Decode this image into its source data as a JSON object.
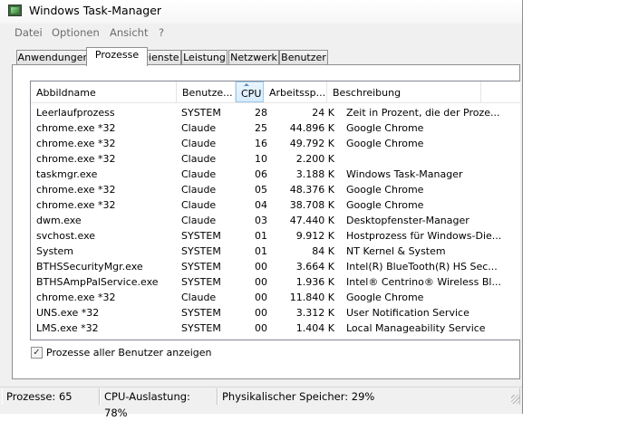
{
  "window": {
    "title": "Windows Task-Manager"
  },
  "menu": [
    "Datei",
    "Optionen",
    "Ansicht",
    "?"
  ],
  "tabs": [
    {
      "label": "Anwendungen",
      "active": false
    },
    {
      "label": "Prozesse",
      "active": true
    },
    {
      "label": "Dienste",
      "active": false
    },
    {
      "label": "Leistung",
      "active": false
    },
    {
      "label": "Netzwerk",
      "active": false
    },
    {
      "label": "Benutzer",
      "active": false
    }
  ],
  "table": {
    "columns": [
      "Abbildname",
      "Benutze...",
      "CPU",
      "Arbeitssp...",
      "Beschreibung"
    ],
    "sorted_column": "CPU",
    "rows": [
      [
        "Leerlaufprozess",
        "SYSTEM",
        "28",
        "24 K",
        "Zeit in Prozent, die der Proze..."
      ],
      [
        "chrome.exe *32",
        "Claude",
        "25",
        "44.896 K",
        "Google Chrome"
      ],
      [
        "chrome.exe *32",
        "Claude",
        "16",
        "49.792 K",
        "Google Chrome"
      ],
      [
        "chrome.exe *32",
        "Claude",
        "10",
        "2.200 K",
        ""
      ],
      [
        "taskmgr.exe",
        "Claude",
        "06",
        "3.188 K",
        "Windows Task-Manager"
      ],
      [
        "chrome.exe *32",
        "Claude",
        "05",
        "48.376 K",
        "Google Chrome"
      ],
      [
        "chrome.exe *32",
        "Claude",
        "04",
        "38.708 K",
        "Google Chrome"
      ],
      [
        "dwm.exe",
        "Claude",
        "03",
        "47.440 K",
        "Desktopfenster-Manager"
      ],
      [
        "svchost.exe",
        "SYSTEM",
        "01",
        "9.912 K",
        "Hostprozess für Windows-Die..."
      ],
      [
        "System",
        "SYSTEM",
        "01",
        "84 K",
        "NT Kernel & System"
      ],
      [
        "BTHSSecurityMgr.exe",
        "SYSTEM",
        "00",
        "3.664 K",
        "Intel(R) BlueTooth(R) HS Sec..."
      ],
      [
        "BTHSAmpPalService.exe",
        "SYSTEM",
        "00",
        "1.936 K",
        "Intel® Centrino® Wireless Bl..."
      ],
      [
        "chrome.exe *32",
        "Claude",
        "00",
        "11.840 K",
        "Google Chrome"
      ],
      [
        "UNS.exe *32",
        "SYSTEM",
        "00",
        "3.312 K",
        "User Notification Service"
      ],
      [
        "LMS.exe *32",
        "SYSTEM",
        "00",
        "1.404 K",
        "Local Manageability Service"
      ]
    ]
  },
  "show_all_users": {
    "label": "Prozesse aller Benutzer anzeigen",
    "checked": true,
    "mark": "✓"
  },
  "status": {
    "processes": "Prozesse: 65",
    "cpu": "CPU-Auslastung: 78%",
    "memory": "Physikalischer Speicher: 29%"
  }
}
